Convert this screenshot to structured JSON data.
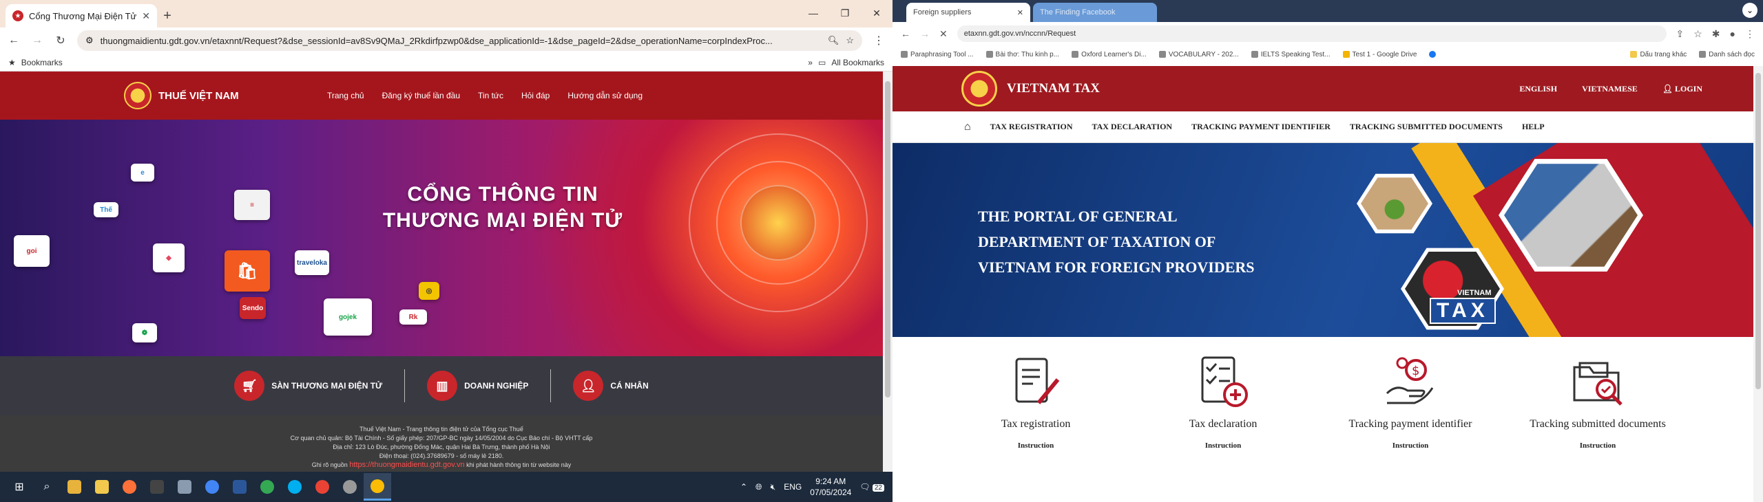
{
  "left_browser": {
    "tab_title": "Cổng Thương Mại Điện Tử",
    "url": "thuongmaidientu.gdt.gov.vn/etaxnnt/Request?&dse_sessionId=av8Sv9QMaJ_2Rkdirfpzwp0&dse_applicationId=-1&dse_pageId=2&dse_operationName=corpIndexProc...",
    "bookmarks_label": "Bookmarks",
    "all_bookmarks_label": "All Bookmarks"
  },
  "left_site": {
    "brand": "THUẾ VIỆT NAM",
    "nav": [
      "Trang chủ",
      "Đăng ký thuế lần đầu",
      "Tin tức",
      "Hỏi đáp",
      "Hướng dẫn sử dụng"
    ],
    "banner_title_line1": "CỔNG THÔNG TIN",
    "banner_title_line2": "THƯƠNG MẠI ĐIỆN TỬ",
    "categories": [
      "SÀN THƯƠNG MẠI ĐIỆN TỬ",
      "DOANH NGHIỆP",
      "CÁ NHÂN"
    ],
    "footer": {
      "line1": "Thuế Việt Nam - Trang thông tin điện tử của Tổng cục Thuế",
      "line2": "Cơ quan chủ quản: Bộ Tài Chính - Số giấy phép: 207/GP-BC ngày 14/05/2004 do Cục Báo chí - Bộ VHTT cấp",
      "line3": "Địa chỉ: 123 Lò Đúc, phường Đống Mác, quận Hai Bà Trưng, thành phố Hà Nội",
      "line4": "Điện thoại: (024).37689679 - số máy lẻ 2180.",
      "line5_prefix": "Ghi rõ nguồn",
      "line5_link": "https://thuongmaidientu.gdt.gov.vn",
      "line5_suffix": "khi phát hành thông tin từ website này"
    }
  },
  "taskbar": {
    "lang": "ENG",
    "time": "9:24 AM",
    "date": "07/05/2024",
    "notification_count": "22"
  },
  "right_browser": {
    "tab1_title": "Foreign suppliers",
    "tab2_title": "The Finding Facebook",
    "url": "etaxnn.gdt.gov.vn/nccnn/Request",
    "bookmarks": [
      "Paraphrasing Tool ...",
      "Bài thơ: Thu kinh p...",
      "Oxford Learner's Di...",
      "VOCABULARY - 202...",
      "IELTS Speaking Test...",
      "Test 1 - Google Drive"
    ],
    "bookmark_right1": "Dấu trang khác",
    "bookmark_right2": "Danh sách đọc"
  },
  "right_site": {
    "brand": "VIETNAM TAX",
    "langs": [
      "ENGLISH",
      "VIETNAMESE",
      "LOGIN"
    ],
    "nav": [
      "TAX REGISTRATION",
      "TAX DECLARATION",
      "TRACKING PAYMENT IDENTIFIER",
      "TRACKING SUBMITTED DOCUMENTS",
      "HELP"
    ],
    "banner_line1": "THE PORTAL OF GENERAL",
    "banner_line2": "DEPARTMENT OF TAXATION OF",
    "banner_line3": "VIETNAM FOR FOREIGN PROVIDERS",
    "banner_tax_word": "TAX",
    "banner_vn_word": "VIETNAM",
    "services": [
      {
        "label": "Tax registration",
        "instr": "Instruction"
      },
      {
        "label": "Tax declaration",
        "instr": "Instruction"
      },
      {
        "label": "Tracking payment identifier",
        "instr": "Instruction"
      },
      {
        "label": "Tracking submitted documents",
        "instr": "Instruction"
      }
    ]
  }
}
